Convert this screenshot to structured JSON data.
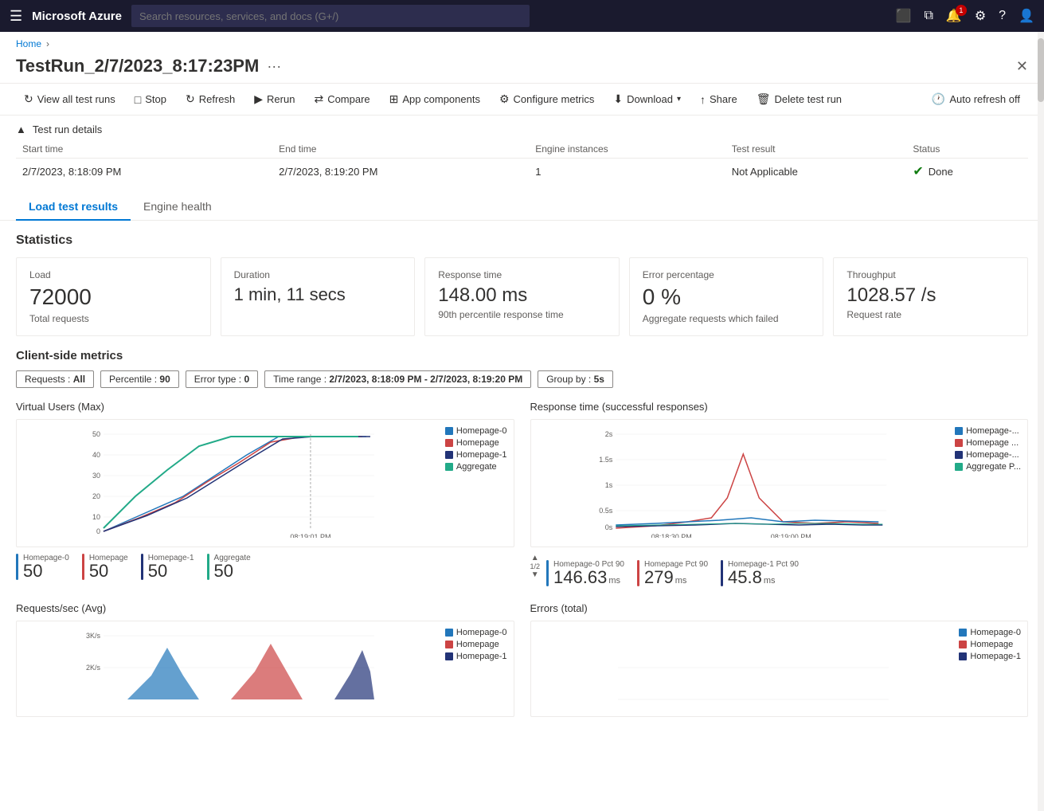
{
  "topbar": {
    "app_name": "Microsoft Azure",
    "search_placeholder": "Search resources, services, and docs (G+/)",
    "notification_count": "1"
  },
  "breadcrumb": {
    "home": "Home",
    "separator": "›"
  },
  "page": {
    "title": "TestRun_2/7/2023_8:17:23PM",
    "more_label": "···",
    "close_label": "✕"
  },
  "toolbar": {
    "view_all": "View all test runs",
    "stop": "Stop",
    "refresh": "Refresh",
    "rerun": "Rerun",
    "compare": "Compare",
    "app_components": "App components",
    "configure_metrics": "Configure metrics",
    "download": "Download",
    "share": "Share",
    "delete": "Delete test run",
    "auto_refresh": "Auto refresh off"
  },
  "test_run_details": {
    "section_label": "Test run details",
    "columns": [
      "Start time",
      "End time",
      "Engine instances",
      "Test result",
      "Status"
    ],
    "row": {
      "start_time": "2/7/2023, 8:18:09 PM",
      "end_time": "2/7/2023, 8:19:20 PM",
      "engine_instances": "1",
      "test_result": "Not Applicable",
      "status": "Done"
    }
  },
  "tabs": [
    {
      "id": "load",
      "label": "Load test results",
      "active": true
    },
    {
      "id": "engine",
      "label": "Engine health",
      "active": false
    }
  ],
  "statistics": {
    "title": "Statistics",
    "cards": [
      {
        "label": "Load",
        "value": "72000",
        "sub": "Total requests"
      },
      {
        "label": "Duration",
        "value": "1 min, 11 secs",
        "sub": ""
      },
      {
        "label": "Response time",
        "value": "148.00 ms",
        "sub": "90th percentile response time"
      },
      {
        "label": "Error percentage",
        "value": "0 %",
        "sub": "Aggregate requests which failed"
      },
      {
        "label": "Throughput",
        "value": "1028.57 /s",
        "sub": "Request rate"
      }
    ]
  },
  "client_metrics": {
    "title": "Client-side metrics",
    "filters": [
      {
        "label": "Requests :",
        "value": "All"
      },
      {
        "label": "Percentile :",
        "value": "90"
      },
      {
        "label": "Error type :",
        "value": "0"
      },
      {
        "label": "Time range :",
        "value": "2/7/2023, 8:18:09 PM - 2/7/2023, 8:19:20 PM"
      },
      {
        "label": "Group by :",
        "value": "5s"
      }
    ]
  },
  "charts": {
    "virtual_users": {
      "title": "Virtual Users (Max)",
      "y_labels": [
        "50",
        "40",
        "30",
        "20",
        "10",
        "0"
      ],
      "x_label": "08:19:01 PM",
      "legend": [
        {
          "color": "#2277bb",
          "label": "Homepage-0"
        },
        {
          "color": "#cc4444",
          "label": "Homepage"
        },
        {
          "color": "#223377",
          "label": "Homepage-1"
        },
        {
          "color": "#22aa88",
          "label": "Aggregate"
        }
      ],
      "metric_values": [
        {
          "label": "Homepage-0",
          "value": "50",
          "unit": "",
          "color": "#2277bb"
        },
        {
          "label": "Homepage",
          "value": "50",
          "unit": "",
          "color": "#cc4444"
        },
        {
          "label": "Homepage-1",
          "value": "50",
          "unit": "",
          "color": "#223377"
        },
        {
          "label": "Aggregate",
          "value": "50",
          "unit": "",
          "color": "#22aa88"
        }
      ]
    },
    "response_time": {
      "title": "Response time (successful responses)",
      "y_labels": [
        "2s",
        "1.5s",
        "1s",
        "0.5s",
        "0s"
      ],
      "legend": [
        {
          "color": "#2277bb",
          "label": "Homepage-..."
        },
        {
          "color": "#cc4444",
          "label": "Homepage ..."
        },
        {
          "color": "#223377",
          "label": "Homepage-..."
        },
        {
          "color": "#22aa88",
          "label": "Aggregate P..."
        }
      ],
      "x_labels": [
        "08:18:30 PM",
        "08:19:00 PM"
      ],
      "metric_values": [
        {
          "label": "Homepage-0 Pct 90",
          "value": "146.63",
          "unit": "ms",
          "color": "#2277bb"
        },
        {
          "label": "Homepage Pct 90",
          "value": "279",
          "unit": "ms",
          "color": "#cc4444"
        },
        {
          "label": "Homepage-1 Pct 90",
          "value": "45.8",
          "unit": "ms",
          "color": "#223377"
        }
      ]
    },
    "requests_sec": {
      "title": "Requests/sec (Avg)",
      "y_labels": [
        "3K/s",
        "2K/s"
      ],
      "legend": [
        {
          "color": "#2277bb",
          "label": "Homepage-0"
        },
        {
          "color": "#cc4444",
          "label": "Homepage"
        },
        {
          "color": "#223377",
          "label": "Homepage-1"
        }
      ]
    },
    "errors": {
      "title": "Errors (total)",
      "legend": [
        {
          "color": "#2277bb",
          "label": "Homepage-0"
        },
        {
          "color": "#cc4444",
          "label": "Homepage"
        },
        {
          "color": "#223377",
          "label": "Homepage-1"
        }
      ]
    }
  }
}
